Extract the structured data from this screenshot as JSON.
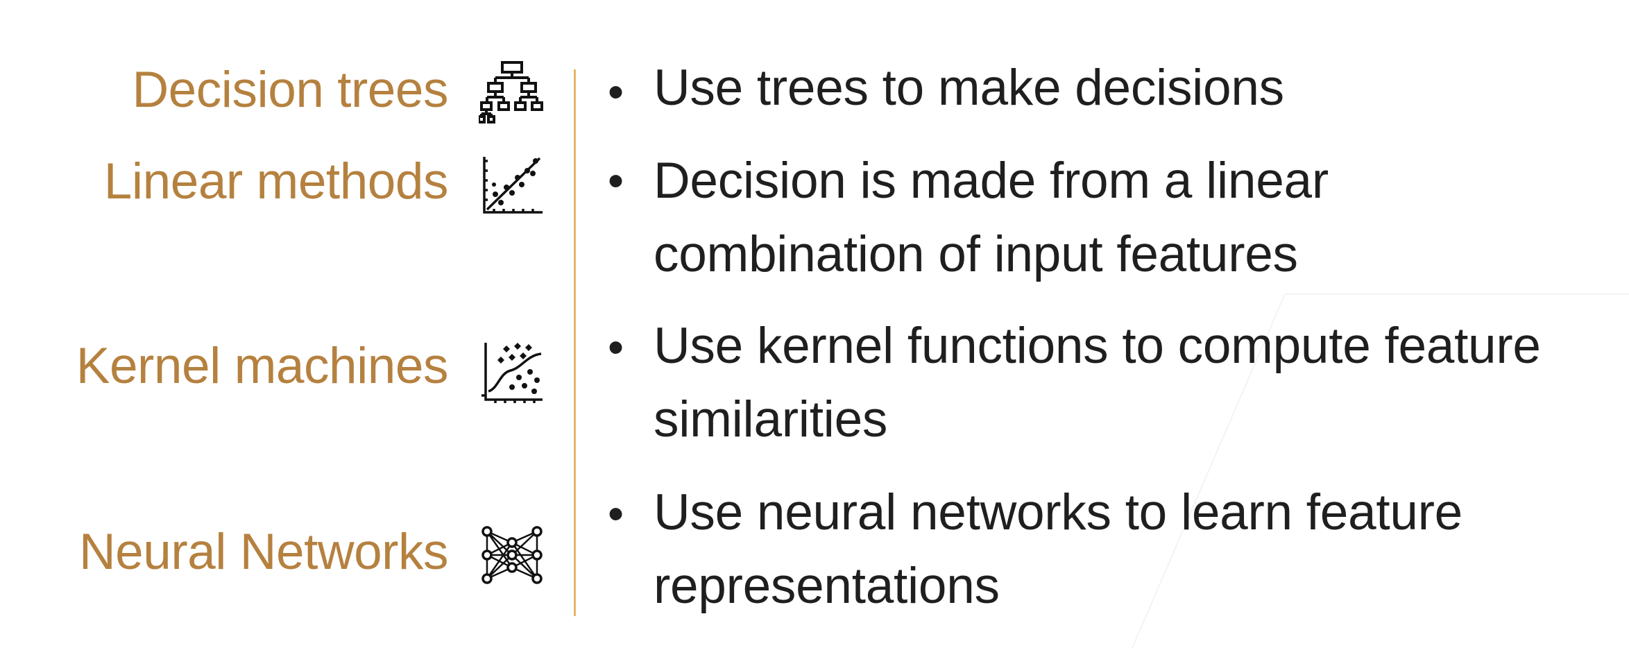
{
  "slide": {
    "accent_color": "#b5813f",
    "divider_color": "#e9b56a",
    "text_color": "#1f1f1f",
    "rows": [
      {
        "term": "Decision trees",
        "icon": "decision-tree-icon",
        "description": "Use trees to make decisions"
      },
      {
        "term": "Linear methods",
        "icon": "linear-regression-icon",
        "description": "Decision is made from a linear combination of input features"
      },
      {
        "term": "Kernel machines",
        "icon": "kernel-scatter-icon",
        "description": "Use kernel functions to compute feature similarities"
      },
      {
        "term": "Neural Networks",
        "icon": "neural-network-icon",
        "description": "Use neural networks to learn feature representations"
      }
    ]
  }
}
